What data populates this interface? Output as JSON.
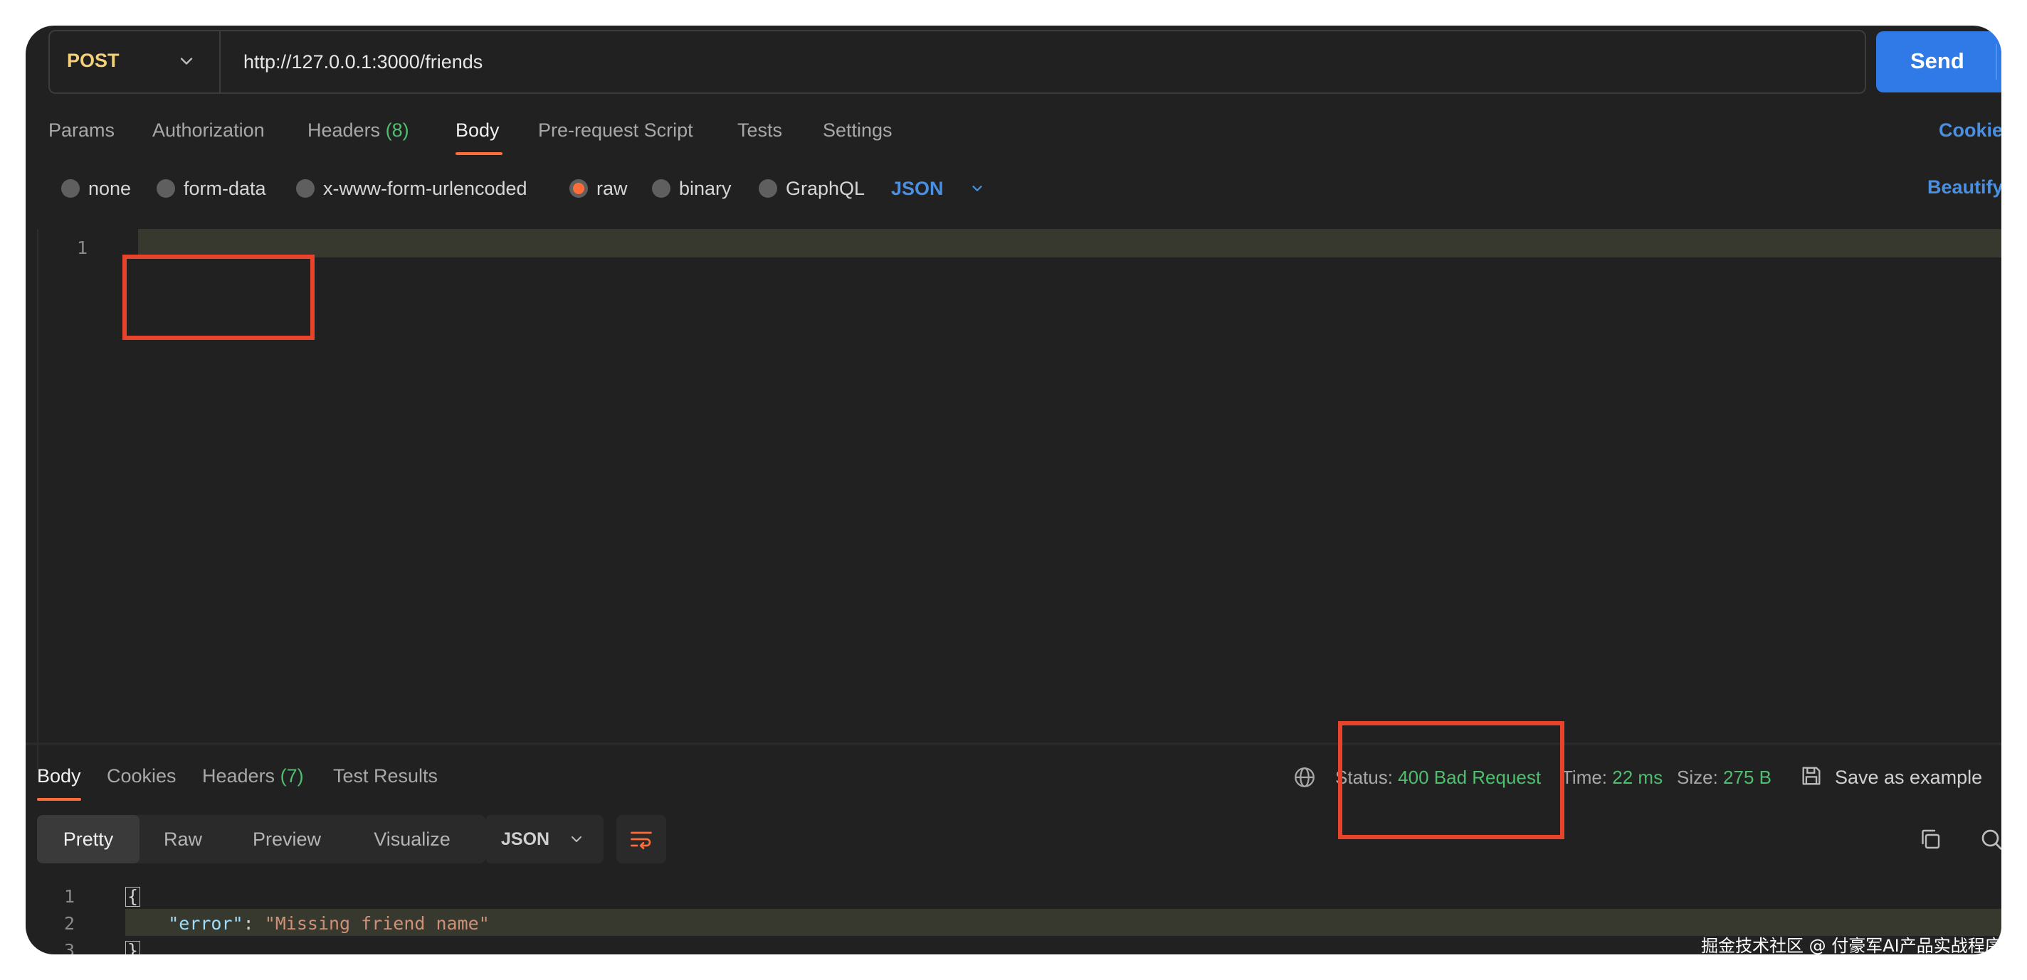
{
  "request": {
    "method": "POST",
    "url": "http://127.0.0.1:3000/friends",
    "send_label": "Send"
  },
  "request_tabs": {
    "params": "Params",
    "authorization": "Authorization",
    "headers": "Headers",
    "headers_count": "(8)",
    "body": "Body",
    "prerequest": "Pre-request Script",
    "tests": "Tests",
    "settings": "Settings",
    "active": "Body",
    "cookies_link": "Cookie"
  },
  "body_types": {
    "options": [
      "none",
      "form-data",
      "x-www-form-urlencoded",
      "raw",
      "binary",
      "GraphQL"
    ],
    "selected": "raw",
    "language": "JSON",
    "beautify": "Beautify"
  },
  "request_editor": {
    "line_numbers": [
      "1"
    ],
    "content": ""
  },
  "response_tabs": {
    "body": "Body",
    "cookies": "Cookies",
    "headers": "Headers",
    "headers_count": "(7)",
    "test_results": "Test Results",
    "active": "Body"
  },
  "response_meta": {
    "status_label": "Status:",
    "status_value": "400 Bad Request",
    "time_label": "Time:",
    "time_value": "22 ms",
    "size_label": "Size:",
    "size_value": "275 B",
    "save_example": "Save as example"
  },
  "response_view": {
    "modes": [
      "Pretty",
      "Raw",
      "Preview",
      "Visualize"
    ],
    "active": "Pretty",
    "format": "JSON"
  },
  "response_body": {
    "line_numbers": [
      "1",
      "2",
      "3"
    ],
    "open_brace": "{",
    "key": "\"error\"",
    "colon": ": ",
    "value": "\"Missing friend name\"",
    "close_brace": "}"
  },
  "watermark": "掘金技术社区 @ 付豪军AI产品实战程序员",
  "colors": {
    "accent_orange": "#ff6c37",
    "send_blue": "#2f7ae6",
    "link_blue": "#4a90e2",
    "status_green": "#4fbf6f",
    "method_yellow": "#f2d178",
    "annotation_red": "#e8432b"
  },
  "icons": {
    "method_dropdown": "chevron-down-icon",
    "send_dropdown": "chevron-down-icon",
    "response_network": "globe-icon",
    "save": "save-icon",
    "wrap": "wrap-lines-icon",
    "copy": "copy-icon",
    "search": "search-icon"
  }
}
